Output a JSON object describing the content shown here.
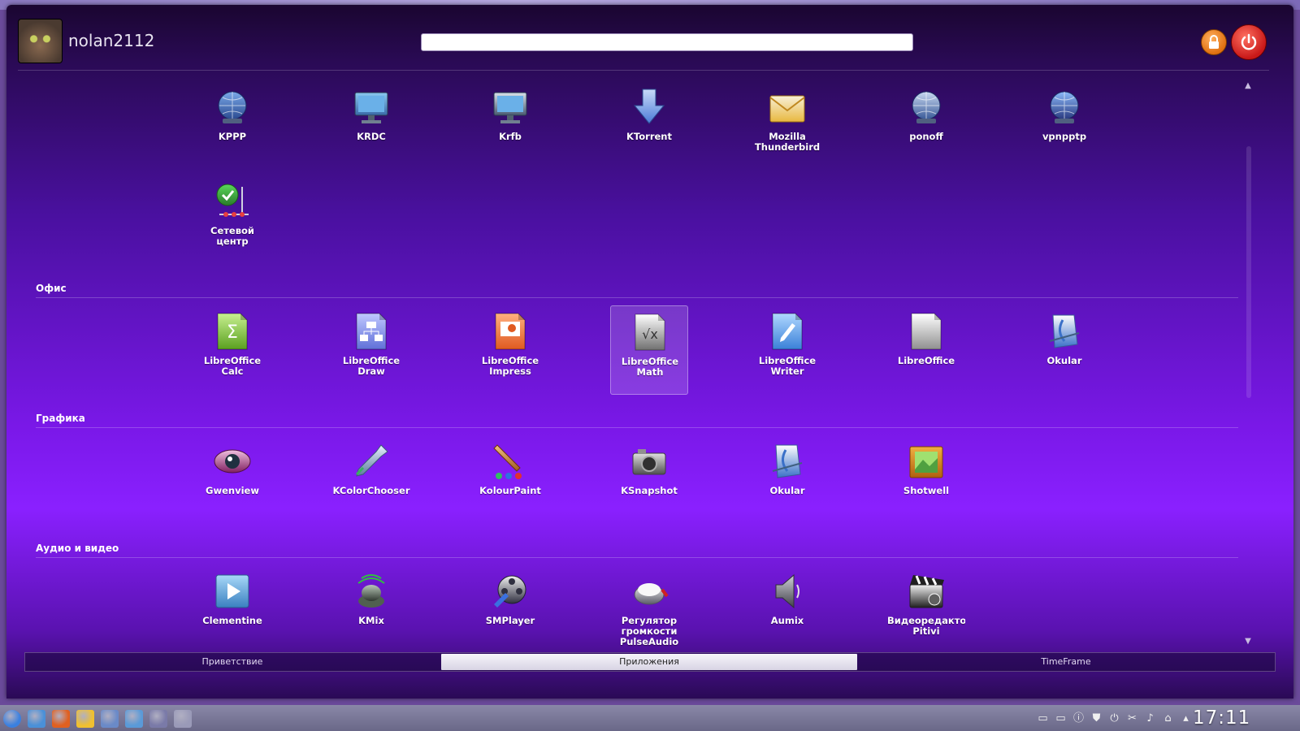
{
  "user": {
    "name": "nolan2112"
  },
  "search": {
    "placeholder": ""
  },
  "categories": [
    {
      "name": "",
      "apps": [
        {
          "label": "KPPP",
          "icon": "globe-modem-icon"
        },
        {
          "label": "KRDC",
          "icon": "remote-desktop-icon"
        },
        {
          "label": "Krfb",
          "icon": "desktop-sharing-icon"
        },
        {
          "label": "KTorrent",
          "icon": "download-arrow-icon"
        },
        {
          "label": "Mozilla\nThunderbird",
          "icon": "envelope-icon"
        },
        {
          "label": "ponoff",
          "icon": "network-globe-icon"
        },
        {
          "label": "vpnpptp",
          "icon": "vpn-globe-icon"
        },
        {
          "label": "Сетевой\nцентр",
          "icon": "network-center-icon"
        }
      ]
    },
    {
      "name": "Офис",
      "apps": [
        {
          "label": "LibreOffice\nCalc",
          "icon": "spreadsheet-icon"
        },
        {
          "label": "LibreOffice\nDraw",
          "icon": "drawing-icon"
        },
        {
          "label": "LibreOffice\nImpress",
          "icon": "presentation-icon"
        },
        {
          "label": "LibreOffice\nMath",
          "icon": "formula-icon",
          "selected": true
        },
        {
          "label": "LibreOffice\nWriter",
          "icon": "writer-icon"
        },
        {
          "label": "LibreOffice",
          "icon": "document-icon"
        },
        {
          "label": "Okular",
          "icon": "document-viewer-icon"
        }
      ]
    },
    {
      "name": "Графика",
      "apps": [
        {
          "label": "Gwenview",
          "icon": "eye-icon"
        },
        {
          "label": "KColorChooser",
          "icon": "color-picker-icon"
        },
        {
          "label": "KolourPaint",
          "icon": "paintbrush-icon"
        },
        {
          "label": "KSnapshot",
          "icon": "camera-icon"
        },
        {
          "label": "Okular",
          "icon": "document-viewer-icon"
        },
        {
          "label": "Shotwell",
          "icon": "photo-frame-icon"
        }
      ]
    },
    {
      "name": "Аудио и видео",
      "apps": [
        {
          "label": "Clementine",
          "icon": "play-icon"
        },
        {
          "label": "KMix",
          "icon": "speaker-icon"
        },
        {
          "label": "SMPlayer",
          "icon": "film-reel-icon"
        },
        {
          "label": "Регулятор\nгромкости\nPulseAudio",
          "icon": "volume-control-icon"
        },
        {
          "label": "Aumix",
          "icon": "loudspeaker-icon"
        },
        {
          "label": "Видеоредактор\nPitivi",
          "icon": "clapperboard-icon"
        }
      ]
    }
  ],
  "tabs": [
    {
      "label": "Приветствие",
      "active": false
    },
    {
      "label": "Приложения",
      "active": true
    },
    {
      "label": "TimeFrame",
      "active": false
    }
  ],
  "taskbar": {
    "launchers": [
      "kde-menu-icon",
      "file-manager-icon",
      "firefox-icon",
      "chat-icon",
      "mail-icon",
      "media-icon",
      "network-icon",
      "terminal-icon"
    ],
    "tray": [
      "folder-icon",
      "folder-icon",
      "info-icon",
      "shield-icon",
      "power-icon",
      "scissors-icon",
      "volume-icon",
      "network-icon",
      "arrow-up-icon"
    ],
    "clock": "17:11"
  },
  "colors": {
    "accent": "#8a20ff",
    "dark": "#1a0630"
  }
}
